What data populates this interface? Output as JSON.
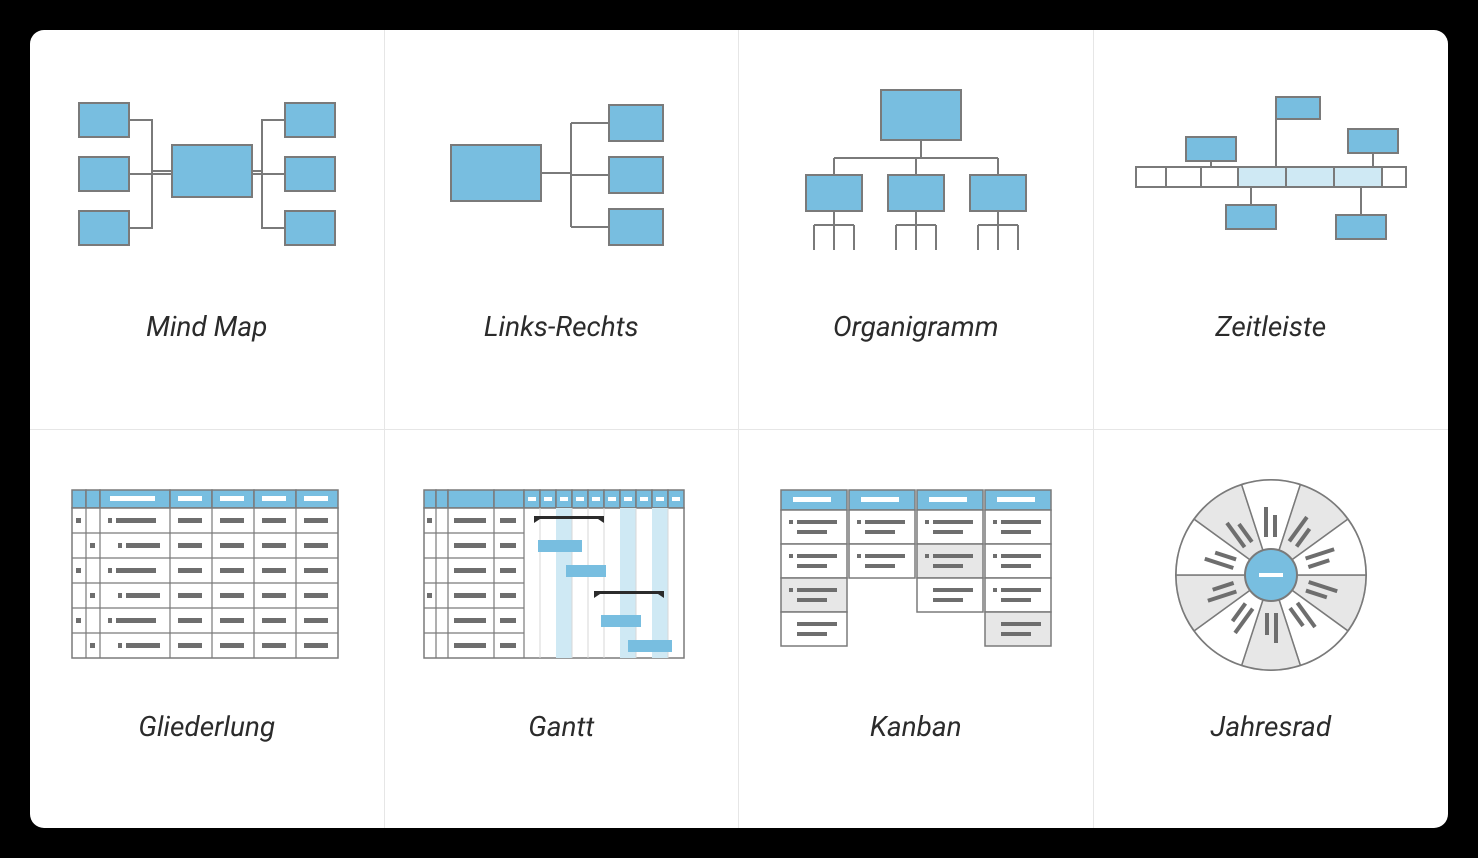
{
  "views": [
    {
      "id": "mindmap",
      "label": "Mind Map"
    },
    {
      "id": "leftright",
      "label": "Links-Rechts"
    },
    {
      "id": "orgchart",
      "label": "Organigramm"
    },
    {
      "id": "timeline",
      "label": "Zeitleiste"
    },
    {
      "id": "outline",
      "label": "Gliederlung"
    },
    {
      "id": "gantt",
      "label": "Gantt"
    },
    {
      "id": "kanban",
      "label": "Kanban"
    },
    {
      "id": "yearwheel",
      "label": "Jahresrad"
    }
  ],
  "colors": {
    "fill": "#78BEE0",
    "light": "#CFE9F4",
    "stroke": "#7A7A7A",
    "grey": "#D7D7D7",
    "darkline": "#6E6E6E"
  }
}
